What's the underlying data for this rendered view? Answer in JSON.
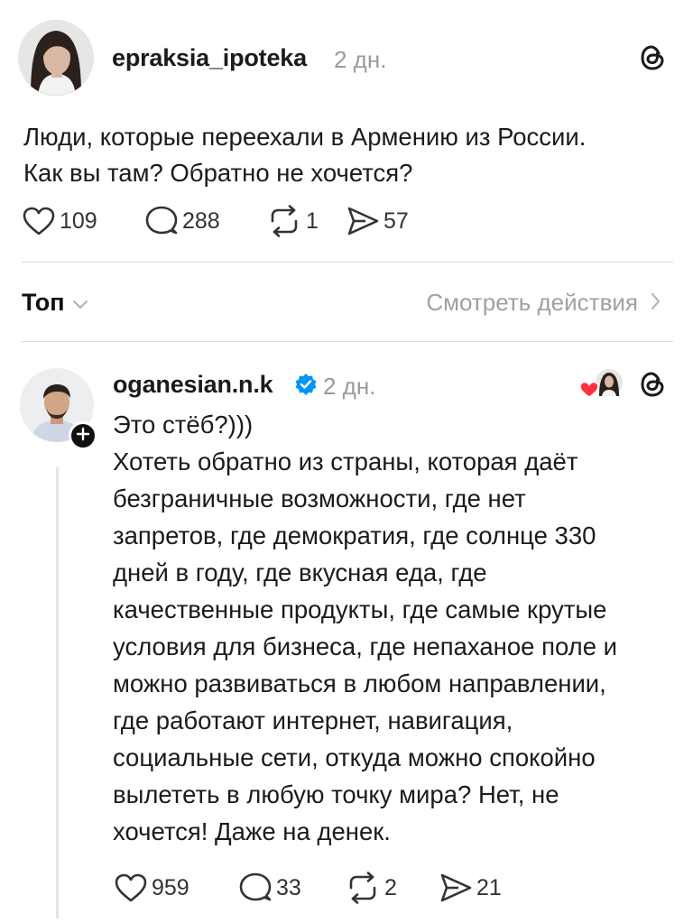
{
  "post": {
    "username": "epraksia_ipoteka",
    "time": "2 дн.",
    "text_lines": [
      "Люди, которые переехали в Армению из России.",
      "Как вы там? Обратно не хочется?"
    ],
    "stats": {
      "likes": "109",
      "comments": "288",
      "reposts": "1",
      "shares": "57"
    }
  },
  "sortbar": {
    "sort_label": "Топ",
    "view_actions_label": "Смотреть действия"
  },
  "reply": {
    "username": "oganesian.n.k",
    "time": "2 дн.",
    "first_line": "Это стёб?)))",
    "body_lines": [
      "Хотеть обратно из страны, которая даёт",
      "безграничные возможности, где нет",
      "запретов, где демократия, где солнце 330",
      "дней в году, где вкусная еда, где",
      "качественные продукты, где самые крутые",
      "условия для бизнеса, где непаханое поле и",
      "можно развиваться в любом направлении,",
      "где работают интернет, навигация,",
      "социальные сети, откуда можно спокойно",
      "вылететь в любую точку мира? Нет, не",
      "хочется! Даже на денек."
    ],
    "stats": {
      "likes": "959",
      "comments": "33",
      "reposts": "2",
      "shares": "21"
    }
  },
  "colors": {
    "text": "#1b1b1b",
    "muted": "#9a9a9a",
    "divider": "#dcdcdc",
    "verified": "#0095f6",
    "heart": "#ff3040"
  },
  "icons": [
    "threads-icon",
    "heart-icon",
    "comment-icon",
    "repost-icon",
    "share-icon",
    "chevron-down-icon",
    "chevron-right-icon",
    "verified-icon",
    "plus-icon"
  ]
}
